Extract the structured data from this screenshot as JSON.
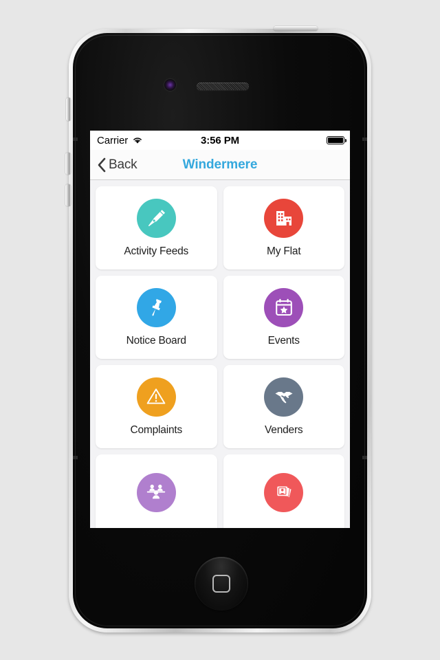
{
  "device": {
    "kind": "smartphone-mockup",
    "home_button": "home-button",
    "hardware": {
      "power_button": "power-button",
      "mute_switch": "mute-switch",
      "volume_up": "volume-up-button",
      "volume_down": "volume-down-button",
      "front_camera": "front-camera",
      "earpiece_speaker": "earpiece-speaker"
    }
  },
  "status_bar": {
    "carrier": "Carrier",
    "wifi_icon": "wifi-icon",
    "time": "3:56 PM",
    "battery_icon": "battery-full-icon"
  },
  "navbar": {
    "back_icon": "chevron-left-icon",
    "back_label": "Back",
    "title": "Windermere",
    "title_color": "#34a8dd"
  },
  "grid": {
    "background": "#f3f3f5",
    "tiles": [
      {
        "label": "Activity Feeds",
        "icon": "pen-nib-icon",
        "color": "#48c7bf",
        "visible_label": true
      },
      {
        "label": "My Flat",
        "icon": "building-icon",
        "color": "#e8463a",
        "visible_label": true
      },
      {
        "label": "Notice Board",
        "icon": "pushpin-icon",
        "color": "#31a7e6",
        "visible_label": true
      },
      {
        "label": "Events",
        "icon": "calendar-star-icon",
        "color": "#9d4fb8",
        "visible_label": true
      },
      {
        "label": "Complaints",
        "icon": "warning-triangle-icon",
        "color": "#efa01f",
        "visible_label": true
      },
      {
        "label": "Venders",
        "icon": "handshake-icon",
        "color": "#69788a",
        "visible_label": true
      },
      {
        "label": "",
        "icon": "meeting-people-icon",
        "color": "#b07fce",
        "visible_label": false
      },
      {
        "label": "",
        "icon": "photo-stack-icon",
        "color": "#f0585a",
        "visible_label": false
      }
    ]
  }
}
